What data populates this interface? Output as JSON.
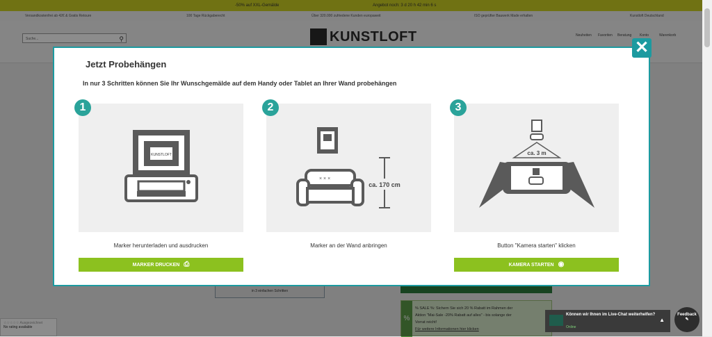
{
  "promo": {
    "sale": "-50% auf XXL-Gemälde",
    "offer": "Angebot noch: 3 d 20 h 42 min 6 s"
  },
  "usp": {
    "items": [
      "Versandkostenfrei ab 42€ & Gratis Retoure",
      "100 Tage Rückgaberecht",
      "Über 320.000 zufriedene Kunden europaweit",
      "ISO geprüfter Bauwerk Made erhalten"
    ],
    "country": "Kunstloft Deutschland"
  },
  "header": {
    "search_placeholder": "Suche...",
    "logo": "KUNSTLOFT",
    "icons": [
      "Neuheiten",
      "Favoriten",
      "Beratung",
      "Konto",
      "Warenkorb"
    ]
  },
  "modal": {
    "title": "Jetzt Probehängen",
    "subtitle": "In nur 3 Schritten können Sie Ihr Wunschgemälde auf dem Handy oder Tablet an Ihrer Wand probehängen",
    "close": "✕",
    "steps": [
      {
        "number": "1",
        "caption": "Marker herunterladen und ausdrucken",
        "button": "MARKER DRUCKEN",
        "label": "KUNSTLOFT"
      },
      {
        "number": "2",
        "caption": "Marker an der Wand anbringen",
        "label": "ca. 170 cm"
      },
      {
        "number": "3",
        "caption": "Button \"Kamera starten\" klicken",
        "button": "KAMERA STARTEN",
        "label": "ca. 3 m"
      }
    ]
  },
  "below": {
    "steps_text": "in 3 einfachen Schritten",
    "sale_pct": "%",
    "sale_line1": "% SALE %: Sichern Sie sich 20 % Rabatt im Rahmen der",
    "sale_line2": "Aktion \"Mai-Sale -20% Rabatt auf alles\" - bis solange der",
    "sale_line3": "Vorrat reicht!",
    "sale_link": "Für weitere Informationen hier klicken"
  },
  "rating": {
    "stars": "☆☆☆☆☆ Ausgezeichnet",
    "text": "No rating available"
  },
  "chat": {
    "title": "Können wir Ihnen im Live-Chat weiterhelfen?",
    "status": "Online"
  },
  "feedback": "Feedback",
  "colors": {
    "accent": "#1c9aa0",
    "button": "#8cc11f",
    "promo": "#cdd024"
  }
}
